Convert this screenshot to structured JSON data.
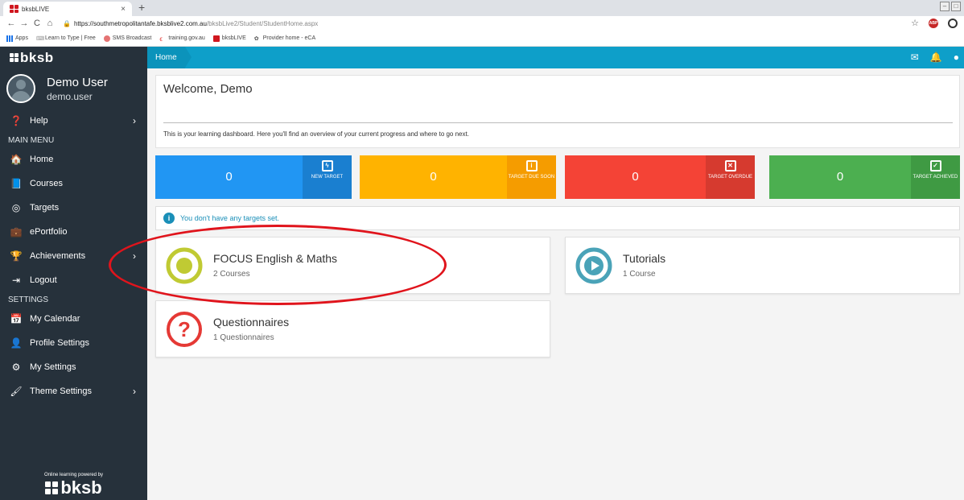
{
  "browser": {
    "tab_title": "bksbLIVE",
    "tab_close": "×",
    "new_tab": "+",
    "url_host": "https://southmetropolitantafe.bksblive2.com.au",
    "url_path": "/bksbLive2/Student/StudentHome.aspx",
    "bookmarks": [
      "Apps",
      "Learn to Type | Free",
      "SMS Broadcast",
      "training.gov.au",
      "bksbLIVE",
      "Provider home - eCA"
    ]
  },
  "sidebar": {
    "logo_text": "bksb",
    "user_name": "Demo User",
    "user_login": "demo.user",
    "help_label": "Help",
    "main_menu_heading": "MAIN MENU",
    "menu": [
      {
        "label": "Home"
      },
      {
        "label": "Courses"
      },
      {
        "label": "Targets"
      },
      {
        "label": "ePortfolio"
      },
      {
        "label": "Achievements"
      },
      {
        "label": "Logout"
      }
    ],
    "settings_heading": "SETTINGS",
    "settings": [
      {
        "label": "My Calendar"
      },
      {
        "label": "Profile Settings"
      },
      {
        "label": "My Settings"
      },
      {
        "label": "Theme Settings"
      }
    ],
    "powered_by": "Online learning powered by",
    "footer_logo": "bksb"
  },
  "topbar": {
    "breadcrumb": "Home"
  },
  "welcome": {
    "title": "Welcome, Demo",
    "description": "This is your learning dashboard. Here you'll find an overview of your current progress and where to go next."
  },
  "stats": [
    {
      "value": "0",
      "label": "NEW TARGET",
      "color": "#2196f3",
      "side_color": "#1a7fd0"
    },
    {
      "value": "0",
      "label": "TARGET DUE SOON",
      "color": "#ffb300",
      "side_color": "#f59c00"
    },
    {
      "value": "0",
      "label": "TARGET OVERDUE",
      "color": "#f44336",
      "side_color": "#d63a2f"
    },
    {
      "value": "0",
      "label": "TARGET ACHIEVED",
      "color": "#4caf50",
      "side_color": "#3f9a43"
    }
  ],
  "info_message": "You don't have any targets set.",
  "cards": [
    {
      "title": "FOCUS English & Maths",
      "subtitle": "2 Courses",
      "ring_color": "#c0ca33"
    },
    {
      "title": "Tutorials",
      "subtitle": "1 Course",
      "ring_color": "#4aa3b8"
    },
    {
      "title": "Questionnaires",
      "subtitle": "1 Questionnaires",
      "ring_color": "#e53935"
    }
  ],
  "annotation_color": "#e0141c"
}
